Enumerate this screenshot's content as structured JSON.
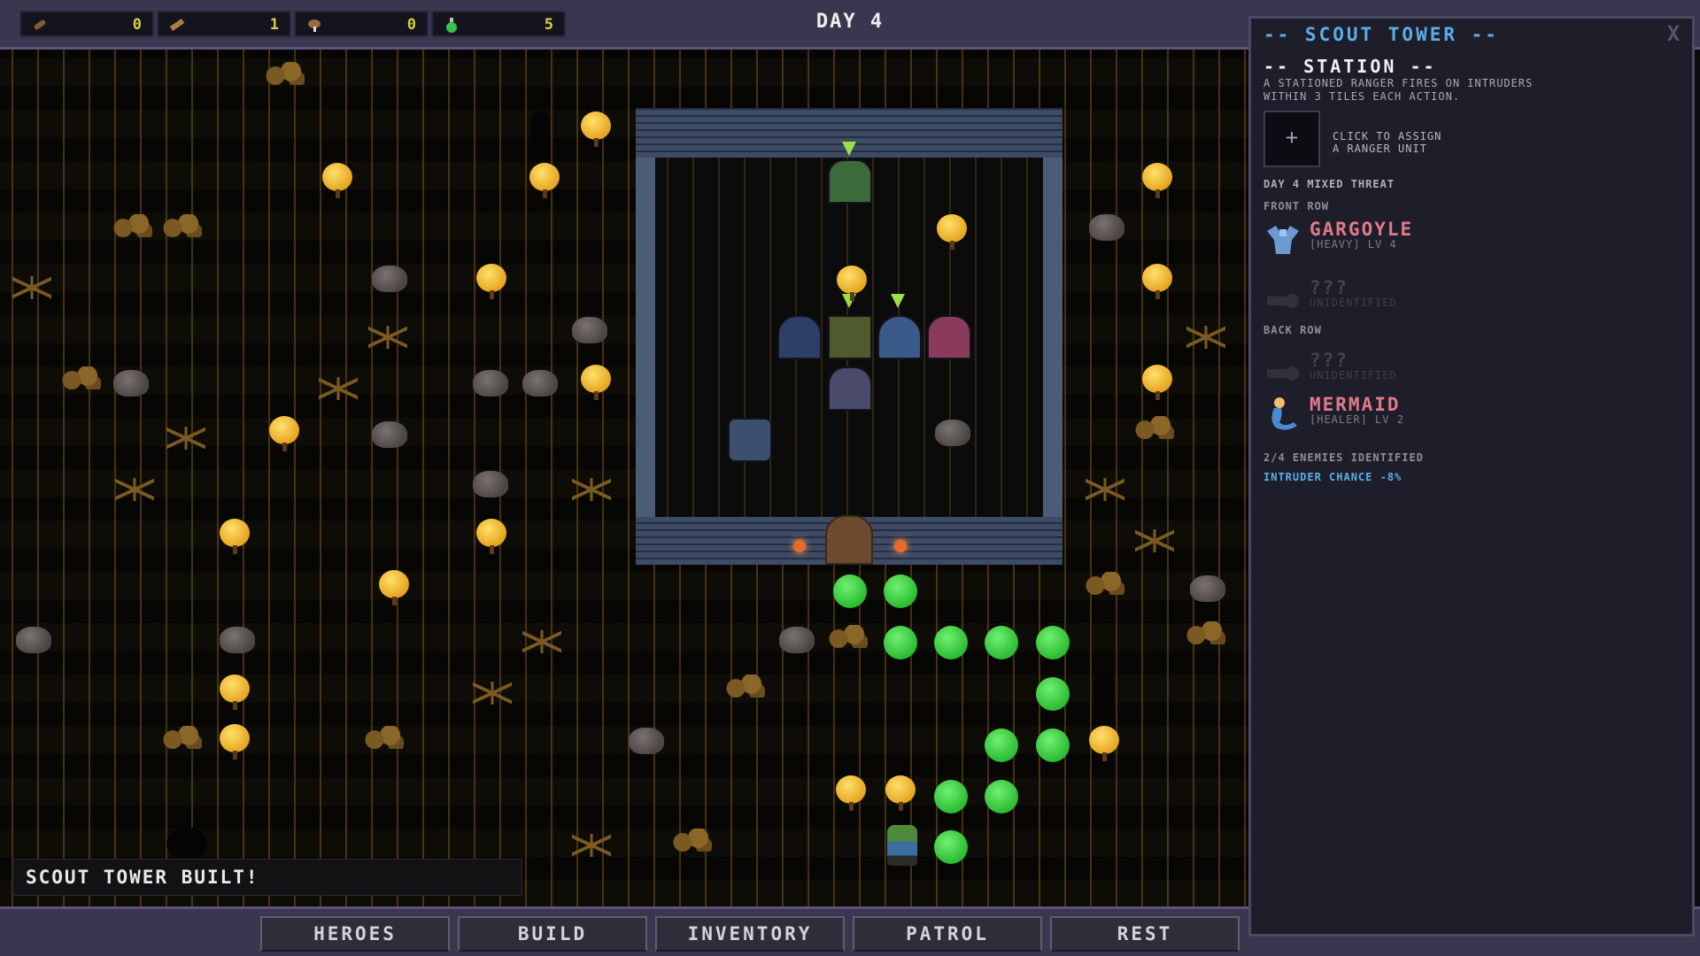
{
  "hud": {
    "resources": [
      {
        "name": "wood-icon",
        "value": "0"
      },
      {
        "name": "plank-icon",
        "value": "1"
      },
      {
        "name": "meat-icon",
        "value": "0"
      },
      {
        "name": "potion-icon",
        "value": "5"
      }
    ],
    "day": "DAY 4"
  },
  "toast": "SCOUT TOWER BUILT!",
  "nav": {
    "heroes": "HEROES",
    "build": "BUILD",
    "inventory": "INVENTORY",
    "patrol": "PATROL",
    "rest": "REST"
  },
  "panel": {
    "title": "-- SCOUT TOWER --",
    "close": "X",
    "station_heading": "-- STATION --",
    "station_desc_1": "A STATIONED RANGER FIRES ON INTRUDERS",
    "station_desc_2": "WITHIN 3 TILES EACH ACTION.",
    "assign_plus": "+",
    "assign_text_1": "CLICK TO ASSIGN",
    "assign_text_2": "A RANGER UNIT",
    "threat": "DAY 4  MIXED THREAT",
    "front_row": "FRONT ROW",
    "back_row": "BACK ROW",
    "enemies": [
      {
        "name": "GARGOYLE",
        "sub": "[HEAVY]  LV 4",
        "color": "#e07a8a"
      },
      {
        "name": "???",
        "sub": "UNIDENTIFIED",
        "color": "#8a8a96"
      },
      {
        "name": "???",
        "sub": "UNIDENTIFIED",
        "color": "#8a8a96"
      },
      {
        "name": "MERMAID",
        "sub": "[HEALER]  LV 2",
        "color": "#e07a8a"
      }
    ],
    "identified": "2/4 ENEMIES IDENTIFIED",
    "intruder": "INTRUDER CHANCE -8%"
  },
  "colors": {
    "accent": "#5aaee8",
    "enemy": "#e07a8a",
    "resource_value": "#d8d040",
    "valid_tile": "#2cbc32"
  }
}
